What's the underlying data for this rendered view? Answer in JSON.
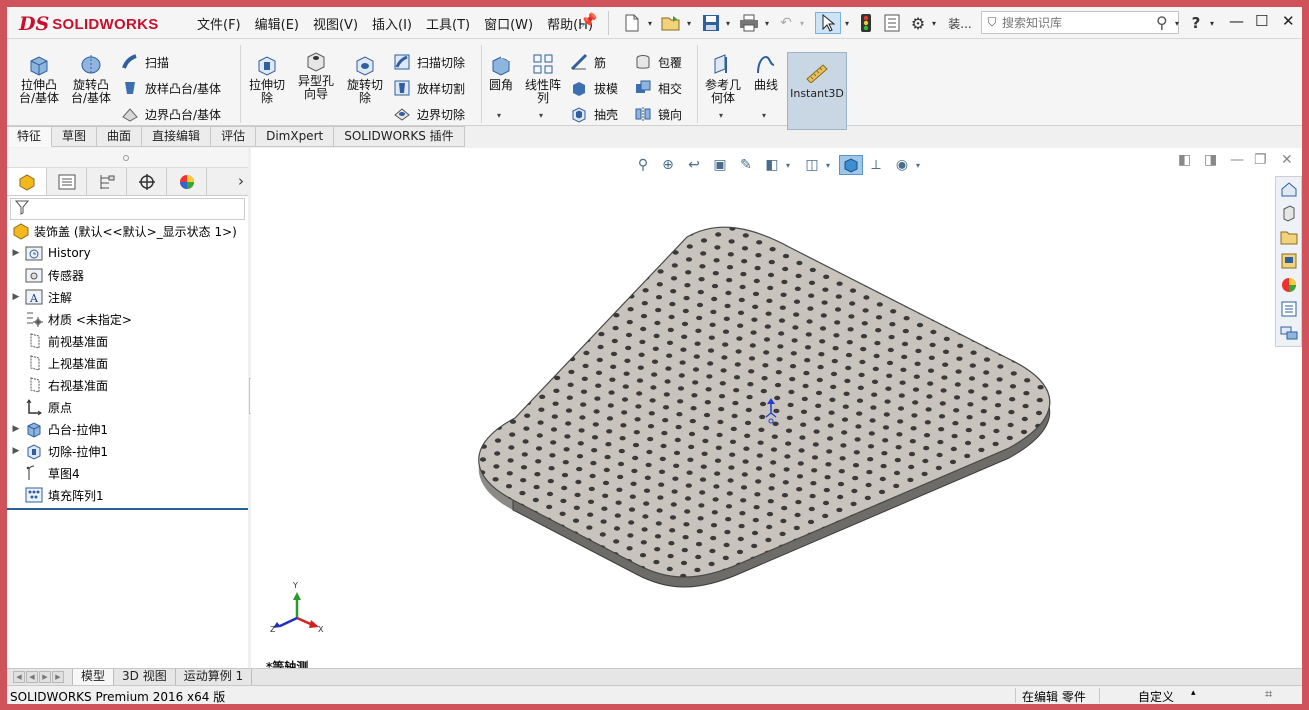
{
  "logo": {
    "brand_prefix": "DS",
    "brand_name": "SOLIDWORKS"
  },
  "menu": [
    {
      "label": "文件(F)",
      "name": "menu-file"
    },
    {
      "label": "编辑(E)",
      "name": "menu-edit"
    },
    {
      "label": "视图(V)",
      "name": "menu-view"
    },
    {
      "label": "插入(I)",
      "name": "menu-insert"
    },
    {
      "label": "工具(T)",
      "name": "menu-tools"
    },
    {
      "label": "窗口(W)",
      "name": "menu-window"
    },
    {
      "label": "帮助(H)",
      "name": "menu-help"
    }
  ],
  "quick_access": {
    "install_label": "装...",
    "help_label": "?"
  },
  "search": {
    "placeholder": "搜索知识库"
  },
  "ribbon": {
    "extrude_boss": "拉伸凸\n台/基体",
    "revolve_boss": "旋转凸\n台/基体",
    "sweep": "扫描",
    "loft_boss": "放样凸台/基体",
    "boundary_boss": "边界凸台/基体",
    "extrude_cut": "拉伸切\n除",
    "hole_wizard": "异型孔\n向导",
    "revolve_cut": "旋转切\n除",
    "sweep_cut": "扫描切除",
    "loft_cut": "放样切割",
    "boundary_cut": "边界切除",
    "fillet": "圆角",
    "linear_pattern": "线性阵\n列",
    "rib": "筋",
    "draft": "拔模",
    "shell": "抽壳",
    "wrap": "包覆",
    "intersect": "相交",
    "mirror": "镜向",
    "ref_geometry": "参考几\n何体",
    "curves": "曲线",
    "instant3d": "Instant3D"
  },
  "command_tabs": [
    {
      "label": "特征",
      "active": true
    },
    {
      "label": "草图",
      "active": false
    },
    {
      "label": "曲面",
      "active": false
    },
    {
      "label": "直接编辑",
      "active": false
    },
    {
      "label": "评估",
      "active": false
    },
    {
      "label": "DimXpert",
      "active": false
    },
    {
      "label": "SOLIDWORKS 插件",
      "active": false
    }
  ],
  "tree": {
    "root": "装饰盖  (默认<<默认>_显示状态 1>)",
    "items": [
      {
        "label": "History",
        "expandable": true,
        "icon": "history-icon"
      },
      {
        "label": "传感器",
        "expandable": false,
        "icon": "sensor-icon"
      },
      {
        "label": "注解",
        "expandable": true,
        "icon": "annotation-icon"
      },
      {
        "label": "材质 <未指定>",
        "expandable": false,
        "icon": "material-icon"
      },
      {
        "label": "前视基准面",
        "expandable": false,
        "icon": "plane-icon"
      },
      {
        "label": "上视基准面",
        "expandable": false,
        "icon": "plane-icon"
      },
      {
        "label": "右视基准面",
        "expandable": false,
        "icon": "plane-icon"
      },
      {
        "label": "原点",
        "expandable": false,
        "icon": "origin-icon"
      },
      {
        "label": "凸台-拉伸1",
        "expandable": true,
        "icon": "boss-extrude-icon"
      },
      {
        "label": "切除-拉伸1",
        "expandable": true,
        "icon": "cut-extrude-icon"
      },
      {
        "label": "草图4",
        "expandable": false,
        "icon": "sketch-icon"
      },
      {
        "label": "填充阵列1",
        "expandable": false,
        "icon": "fill-pattern-icon"
      }
    ]
  },
  "viewport": {
    "view_label": "*等轴测",
    "axis_x": "X",
    "axis_y": "Y",
    "axis_z": "Z"
  },
  "bottom_tabs": [
    {
      "label": "模型",
      "active": true
    },
    {
      "label": "3D 视图",
      "active": false
    },
    {
      "label": "运动算例 1",
      "active": false
    }
  ],
  "status": {
    "app": "SOLIDWORKS Premium 2016 x64 版",
    "mode": "在编辑 零件",
    "units": "自定义"
  },
  "colors": {
    "accent": "#c8102e",
    "part_face": "#c8c4bd",
    "part_edge": "#4a4a4a",
    "frame": "#d0525a"
  }
}
